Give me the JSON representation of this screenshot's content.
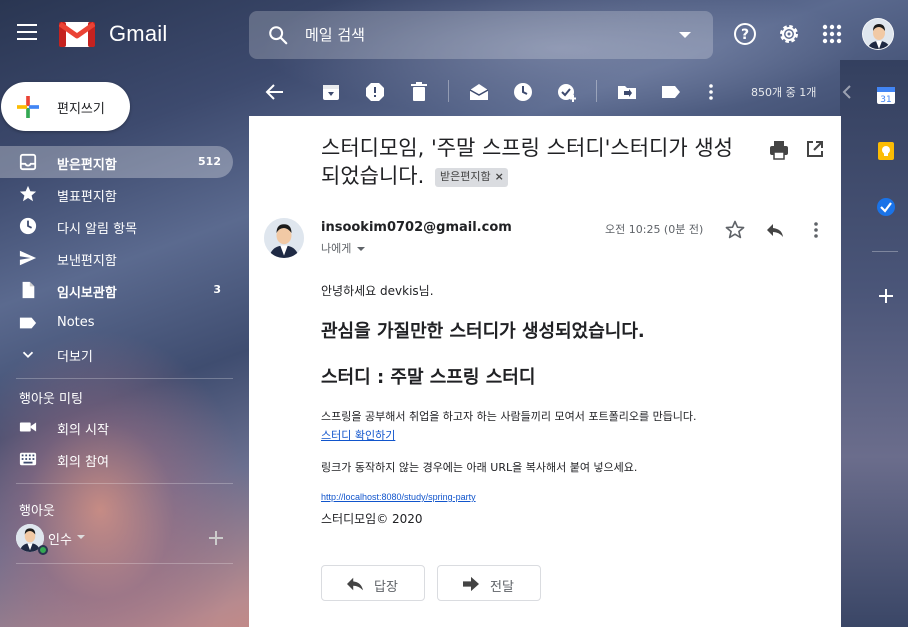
{
  "app": {
    "name": "Gmail"
  },
  "search": {
    "placeholder": "메일 검색"
  },
  "compose": {
    "label": "편지쓰기"
  },
  "sidebar": {
    "items": [
      {
        "label": "받은편지함",
        "count": "512",
        "icon": "inbox-icon",
        "active": true
      },
      {
        "label": "별표편지함",
        "count": "",
        "icon": "star-icon"
      },
      {
        "label": "다시 알림 항목",
        "count": "",
        "icon": "clock-icon"
      },
      {
        "label": "보낸편지함",
        "count": "",
        "icon": "send-icon"
      },
      {
        "label": "임시보관함",
        "count": "3",
        "icon": "draft-icon",
        "bold": true
      },
      {
        "label": "Notes",
        "count": "",
        "icon": "label-icon"
      },
      {
        "label": "더보기",
        "count": "",
        "icon": "chevron-down-icon"
      }
    ],
    "meet": {
      "title": "행아웃 미팅",
      "items": [
        {
          "label": "회의 시작",
          "icon": "video-icon"
        },
        {
          "label": "회의 참여",
          "icon": "keyboard-icon"
        }
      ]
    },
    "hangouts": {
      "title": "행아웃",
      "user": "인수"
    }
  },
  "toolbar": {
    "page_info": "850개 중 1개"
  },
  "mail": {
    "subject": "스터디모임, '주말 스프링 스터디'스터디가 생성되었습니다.",
    "label_chip": "받은편지함",
    "sender": "insookim0702@gmail.com",
    "to": "나에게",
    "time": "오전 10:25 (0분 전)",
    "body": {
      "greeting": "안녕하세요 devkis님.",
      "headline": "관심을 가질만한 스터디가 생성되었습니다.",
      "study": "스터디 : 주말 스프링 스터디",
      "description": "스프링을 공부해서 취업을 하고자 하는 사람들끼리 모여서 포트폴리오를 만듭니다.",
      "link_label": "스터디 확인하기",
      "note": "링크가 동작하지 않는 경우에는 아래 URL을 복사해서 붙여 넣으세요.",
      "url": "http://localhost:8080/study/spring-party",
      "copyright": "스터디모임© 2020"
    },
    "actions": {
      "reply": "답장",
      "forward": "전달"
    }
  },
  "rail": {
    "calendar_day": "31"
  },
  "colors": {
    "accent": "#1a73e8",
    "link": "#1155cc",
    "gmail_red": "#ea4335"
  }
}
